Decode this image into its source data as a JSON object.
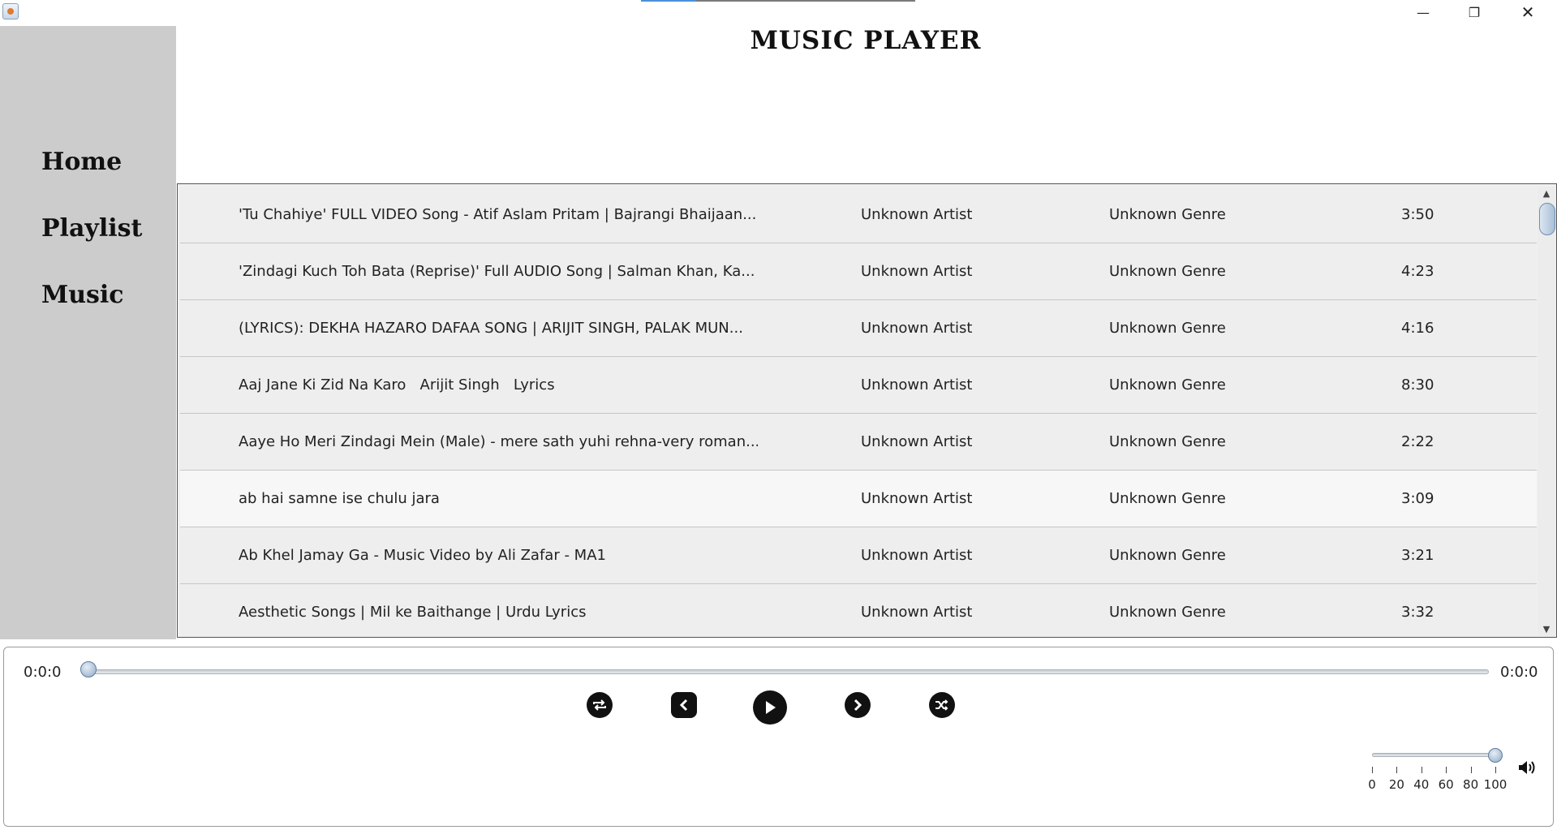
{
  "window": {
    "minimize_glyph": "—",
    "maximize_glyph": "❐",
    "close_glyph": "✕"
  },
  "header": {
    "title": "MUSIC PLAYER"
  },
  "sidebar": {
    "items": [
      {
        "label": "Home"
      },
      {
        "label": "Playlist"
      },
      {
        "label": "Music"
      }
    ]
  },
  "songs": [
    {
      "title": "'Tu Chahiye' FULL VIDEO Song - Atif Aslam Pritam | Bajrangi Bhaijaan...",
      "artist": "Unknown Artist",
      "genre": "Unknown Genre",
      "duration": "3:50"
    },
    {
      "title": "'Zindagi Kuch Toh Bata (Reprise)' Full AUDIO Song | Salman Khan, Ka...",
      "artist": "Unknown Artist",
      "genre": "Unknown Genre",
      "duration": "4:23"
    },
    {
      "title": "(LYRICS): DEKHA HAZARO DAFAA SONG | ARIJIT SINGH, PALAK MUN...",
      "artist": "Unknown Artist",
      "genre": "Unknown Genre",
      "duration": "4:16"
    },
    {
      "title": "Aaj Jane Ki Zid Na Karo   Arijit Singh   Lyrics",
      "artist": "Unknown Artist",
      "genre": "Unknown Genre",
      "duration": "8:30"
    },
    {
      "title": "Aaye Ho Meri Zindagi Mein (Male) - mere sath yuhi rehna-very roman...",
      "artist": "Unknown Artist",
      "genre": "Unknown Genre",
      "duration": "2:22"
    },
    {
      "title": "ab hai samne ise chulu jara",
      "artist": "Unknown Artist",
      "genre": "Unknown Genre",
      "duration": "3:09"
    },
    {
      "title": "Ab Khel Jamay Ga - Music Video by Ali Zafar - MA1",
      "artist": "Unknown Artist",
      "genre": "Unknown Genre",
      "duration": "3:21"
    },
    {
      "title": "Aesthetic Songs | Mil ke Baithange | Urdu Lyrics",
      "artist": "Unknown Artist",
      "genre": "Unknown Genre",
      "duration": "3:32"
    }
  ],
  "player": {
    "current_time": "0:0:0",
    "total_time": "0:0:0",
    "seek_fraction": 0,
    "volume": 100,
    "volume_labels": [
      "0",
      "20",
      "40",
      "60",
      "80",
      "100"
    ],
    "controls": [
      "repeat-icon",
      "previous-icon",
      "play-icon",
      "next-icon",
      "shuffle-icon"
    ]
  }
}
